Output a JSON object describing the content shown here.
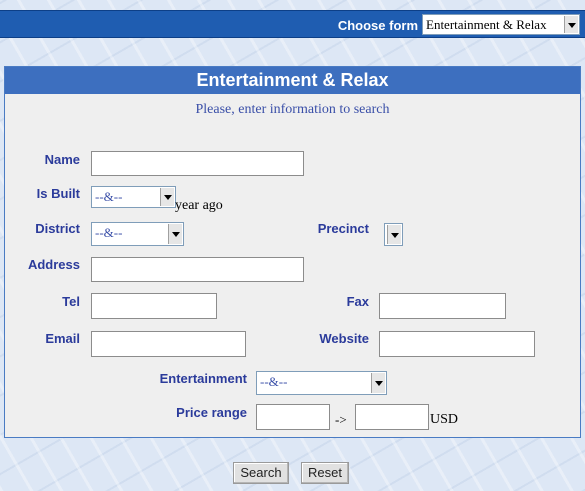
{
  "header": {
    "choose_form_label": "Choose form",
    "form_select_value": "Entertainment & Relax"
  },
  "panel": {
    "title": "Entertainment & Relax",
    "subtitle": "Please, enter information to search"
  },
  "fields": {
    "name_label": "Name",
    "is_built_label": "Is Built",
    "is_built_value": "--&--",
    "is_built_suffix": "year ago",
    "district_label": "District",
    "district_value": "--&--",
    "precinct_label": "Precinct",
    "address_label": "Address",
    "tel_label": "Tel",
    "fax_label": "Fax",
    "email_label": "Email",
    "website_label": "Website",
    "entertainment_label": "Entertainment",
    "entertainment_value": "--&--",
    "price_range_label": "Price range",
    "price_arrow": "->",
    "price_unit": "USD"
  },
  "buttons": {
    "search": "Search",
    "reset": "Reset"
  },
  "colors": {
    "topbar": "#1f5db1",
    "panel_title": "#3d6fbf",
    "label": "#2b3b9b"
  }
}
